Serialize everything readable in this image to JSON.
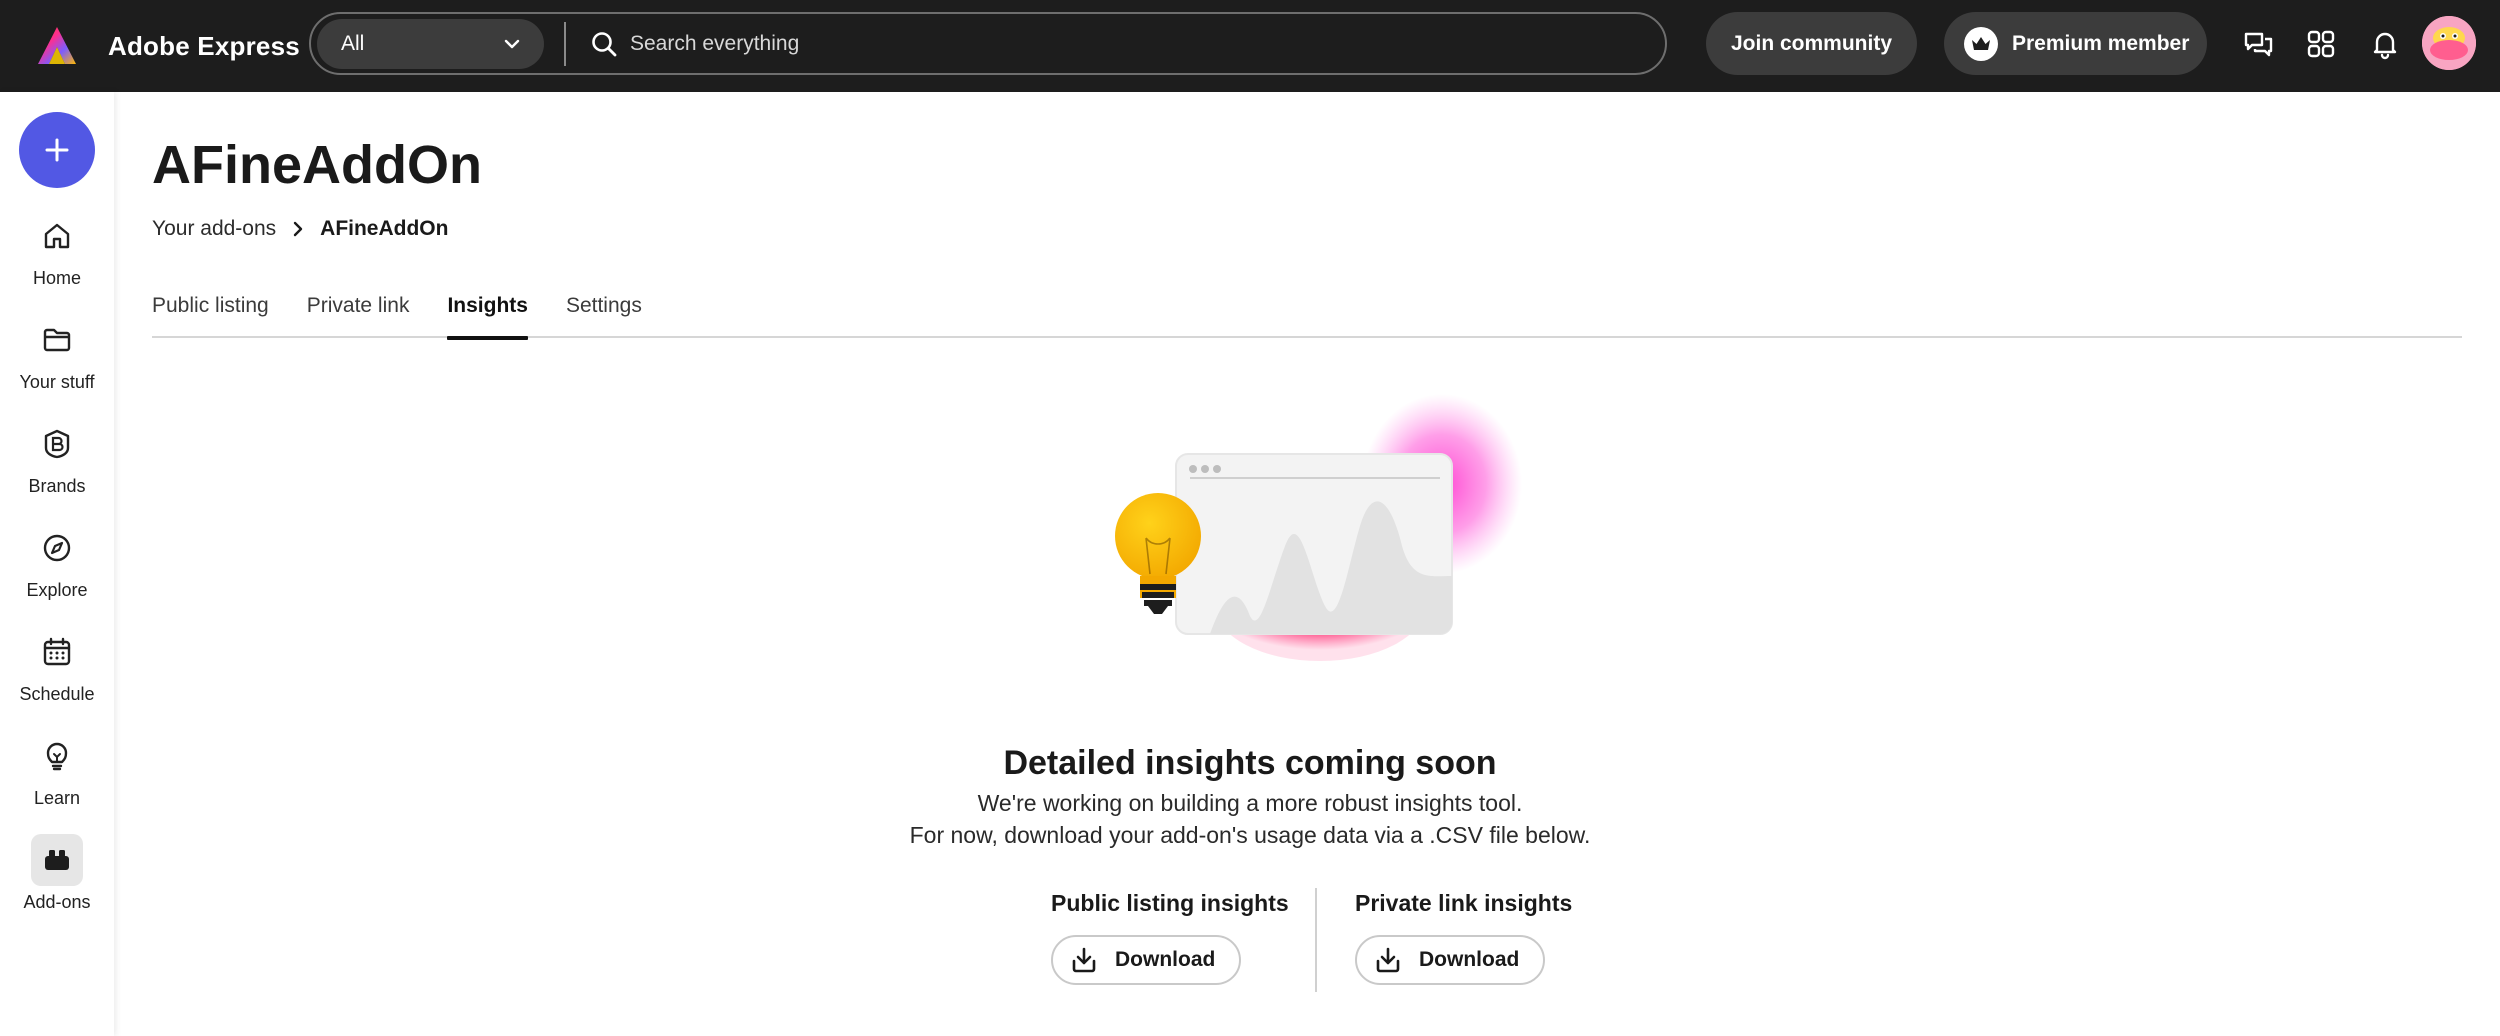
{
  "app": {
    "name": "Adobe Express"
  },
  "search": {
    "scope": "All",
    "placeholder": "Search everything"
  },
  "header": {
    "join_label": "Join community",
    "premium_label": "Premium member",
    "icons": [
      "chat-icon",
      "apps-grid-icon",
      "bell-icon",
      "avatar"
    ]
  },
  "sidebar": {
    "create_icon": "plus-icon",
    "items": [
      {
        "label": "Home",
        "icon": "home-icon"
      },
      {
        "label": "Your stuff",
        "icon": "folder-icon"
      },
      {
        "label": "Brands",
        "icon": "brand-icon"
      },
      {
        "label": "Explore",
        "icon": "compass-icon"
      },
      {
        "label": "Schedule",
        "icon": "calendar-icon"
      },
      {
        "label": "Learn",
        "icon": "lightbulb-icon"
      },
      {
        "label": "Add-ons",
        "icon": "addons-icon",
        "active": true
      }
    ]
  },
  "page": {
    "title": "AFineAddOn",
    "breadcrumb": {
      "parent": "Your add-ons",
      "current": "AFineAddOn"
    },
    "tabs": [
      {
        "label": "Public listing"
      },
      {
        "label": "Private link"
      },
      {
        "label": "Insights",
        "active": true
      },
      {
        "label": "Settings"
      }
    ]
  },
  "insights": {
    "heading": "Detailed insights coming soon",
    "line1": "We're working on building a more robust insights tool.",
    "line2": "For now, download your add-on's usage data via a .CSV file below.",
    "public": {
      "title": "Public listing insights",
      "button": "Download"
    },
    "private": {
      "title": "Private link insights",
      "button": "Download"
    }
  },
  "colors": {
    "topbar": "#1d1d1d",
    "create_button": "#5258e4",
    "accent_pink": "#ff2f8e",
    "bulb_yellow": "#f9b900"
  }
}
